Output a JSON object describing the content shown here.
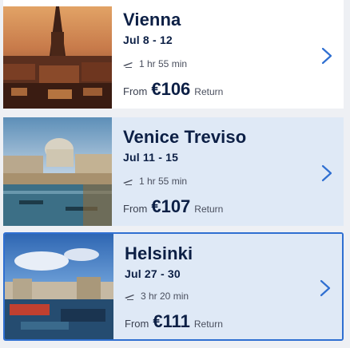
{
  "results": [
    {
      "city": "Vienna",
      "dates": "Jul 8 - 12",
      "duration": "1 hr 55 min",
      "from_label": "From",
      "price": "€106",
      "trip_type": "Return",
      "image": "vienna-cityscape"
    },
    {
      "city": "Venice Treviso",
      "dates": "Jul 11 - 15",
      "duration": "1 hr 55 min",
      "from_label": "From",
      "price": "€107",
      "trip_type": "Return",
      "image": "venice-grand-canal"
    },
    {
      "city": "Helsinki",
      "dates": "Jul 27 - 30",
      "duration": "3 hr 20 min",
      "from_label": "From",
      "price": "€111",
      "trip_type": "Return",
      "image": "helsinki-harbor"
    }
  ],
  "icons": {
    "flight": "plane-icon",
    "open": "chevron-right-icon"
  },
  "colors": {
    "accent": "#2f6fd1",
    "text_dark": "#0c1f45",
    "selected_bg": "#dfe9f6"
  }
}
